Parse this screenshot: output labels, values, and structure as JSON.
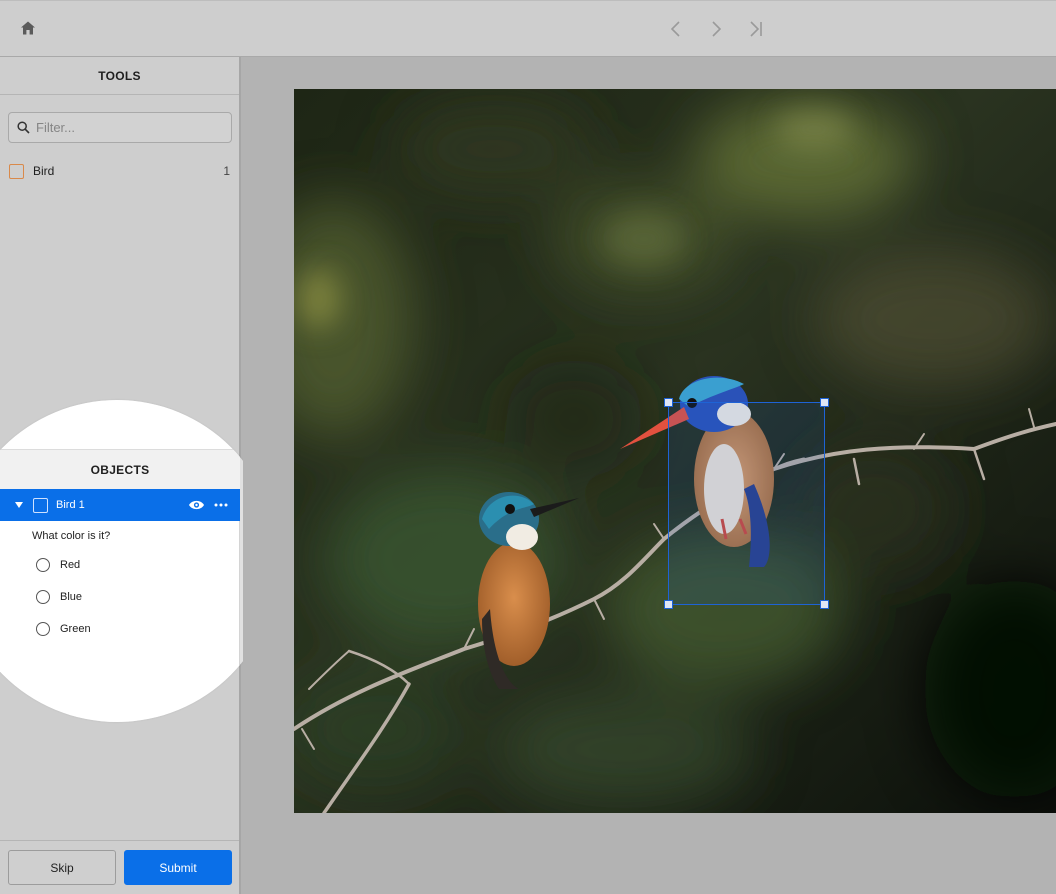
{
  "topbar": {
    "home_icon": "home-icon",
    "nav_icons": [
      "chevron-left-icon",
      "chevron-right-icon",
      "skip-to-end-icon"
    ]
  },
  "tools": {
    "header": "TOOLS",
    "filter_placeholder": "Filter...",
    "items": [
      {
        "label": "Bird",
        "count": "1",
        "color": "#d9894a"
      }
    ]
  },
  "objects": {
    "header": "OBJECTS",
    "items": [
      {
        "label": "Bird 1",
        "selected": true,
        "question": "What color is it?",
        "options": [
          "Red",
          "Blue",
          "Green"
        ]
      }
    ]
  },
  "actions": {
    "skip_label": "Skip",
    "submit_label": "Submit"
  },
  "colors": {
    "accent": "#0a6fe8",
    "bbox": "#1e63d6",
    "tool_bird": "#d9894a"
  }
}
